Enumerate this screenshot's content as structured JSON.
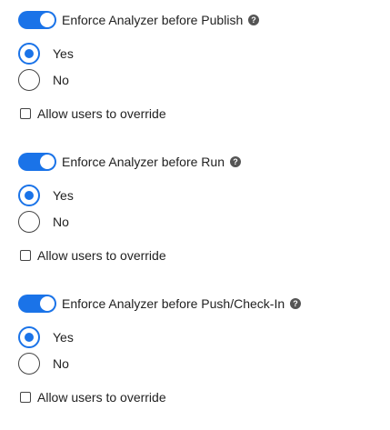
{
  "sections": [
    {
      "toggle": {
        "label": "Enforce Analyzer before Publish",
        "on": true
      },
      "options": [
        {
          "label": "Yes",
          "selected": true
        },
        {
          "label": "No",
          "selected": false
        }
      ],
      "override": {
        "label": "Allow users to override",
        "checked": false
      }
    },
    {
      "toggle": {
        "label": "Enforce Analyzer before Run",
        "on": true
      },
      "options": [
        {
          "label": "Yes",
          "selected": true
        },
        {
          "label": "No",
          "selected": false
        }
      ],
      "override": {
        "label": "Allow users to override",
        "checked": false
      }
    },
    {
      "toggle": {
        "label": "Enforce Analyzer before Push/Check-In",
        "on": true
      },
      "options": [
        {
          "label": "Yes",
          "selected": true
        },
        {
          "label": "No",
          "selected": false
        }
      ],
      "override": {
        "label": "Allow users to override",
        "checked": false
      }
    }
  ],
  "colors": {
    "accent": "#1a73e8",
    "help_icon": "#555555"
  },
  "icons": {
    "help": "question-circle-icon"
  }
}
